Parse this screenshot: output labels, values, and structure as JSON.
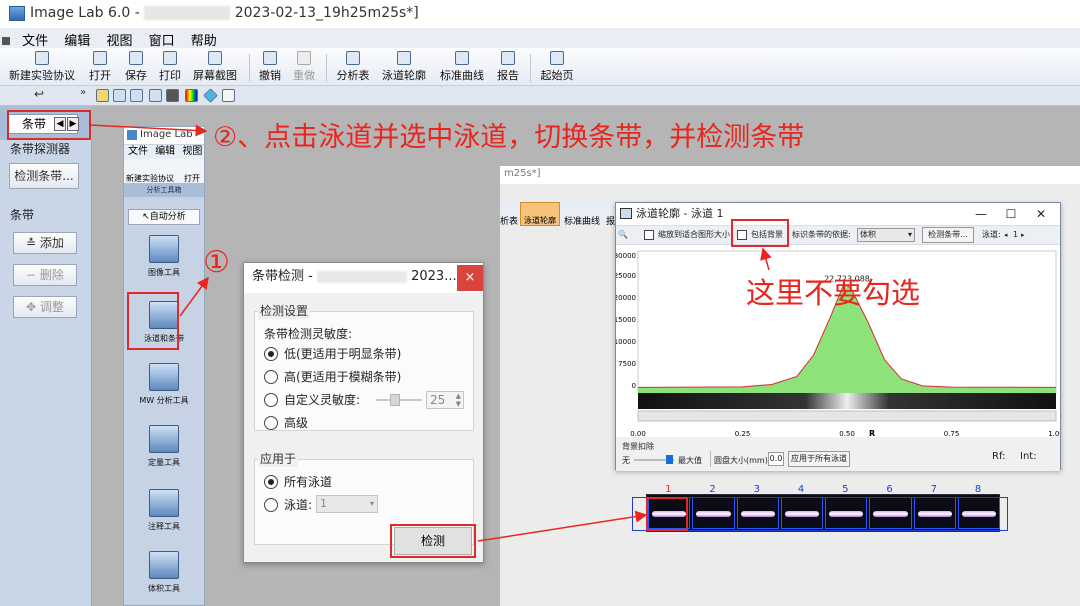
{
  "app": {
    "title_prefix": "Image Lab 6.0 - ",
    "title_suffix": "2023-02-13_19h25m25s*]",
    "menu": [
      "文件",
      "编辑",
      "视图",
      "窗口",
      "帮助"
    ],
    "toolbar": [
      "新建实验协议",
      "打开",
      "保存",
      "打印",
      "屏幕截图",
      "撤销",
      "重做",
      "分析表",
      "泳道轮廓",
      "标准曲线",
      "报告",
      "起始页"
    ],
    "toolbar_disabled": [
      "重做"
    ]
  },
  "left_panel": {
    "tab_label": "条带",
    "section_detector": "条带探测器",
    "detect_button": "检测条带...",
    "section_bands": "条带",
    "add": "添加",
    "delete": "删除",
    "adjust": "调整"
  },
  "inner_window": {
    "title": "Image Lab 6.0",
    "menu": [
      "文件",
      "编辑",
      "视图"
    ],
    "toolbar": [
      "新建实验协议",
      "打开"
    ],
    "strip": "分析工具箱",
    "auto_analyze": "自动分析",
    "tools": [
      "图像工具",
      "泳道和条带",
      "MW 分析工具",
      "定量工具",
      "注释工具",
      "体积工具"
    ]
  },
  "bg_window": {
    "title_fragment": "m25s*]",
    "toolbar": [
      "析表",
      "泳道轮廓",
      "标准曲线",
      "报"
    ]
  },
  "dialog": {
    "title": "条带检测 - ",
    "title_suffix": "2023...",
    "close": "×",
    "group_detect": "检测设置",
    "sensitivity_label": "条带检测灵敏度:",
    "options": [
      "低(更适用于明显条带)",
      "高(更适用于模糊条带)",
      "自定义灵敏度:",
      "高级"
    ],
    "selected_option": 0,
    "custom_value": "25",
    "group_apply": "应用于",
    "apply_options": [
      "所有泳道",
      "泳道:"
    ],
    "selected_apply": 0,
    "lane_value": "1",
    "detect_button": "检测"
  },
  "profile_window": {
    "title": "泳道轮廓 - 泳道 1",
    "minimize": "—",
    "maximize": "☐",
    "close": "✕",
    "fit_label": "缩放到适合图形大小",
    "include_bg": "包括背景",
    "band_basis_label": "标识条带的依据:",
    "band_basis_value": "体积",
    "detect_btn": "检测条带...",
    "lane_label": "泳道:",
    "lane_value": "1",
    "peak_label": "22,723,088",
    "bg_subtract": "背景扣除",
    "slider_min": "无",
    "slider_max": "最大值",
    "disk_size_label": "圆盘大小(mm):",
    "disk_size_value": "0.0",
    "apply_all": "应用于所有泳道",
    "rf_label": "Rf:",
    "int_label": "Int:",
    "r_label": "R"
  },
  "chart_data": {
    "type": "area",
    "y_ticks": [
      "30000",
      "25000",
      "20000",
      "15000",
      "10000",
      "7500",
      "0"
    ],
    "x_ticks": [
      "0.00",
      "0.25",
      "0.50",
      "0.75",
      "1.00"
    ],
    "xlim": [
      0,
      1
    ],
    "ylim": [
      0,
      30000
    ],
    "series": [
      {
        "values": [
          [
            0,
            1200
          ],
          [
            0.25,
            1300
          ],
          [
            0.32,
            1800
          ],
          [
            0.38,
            3500
          ],
          [
            0.42,
            8000
          ],
          [
            0.46,
            16000
          ],
          [
            0.49,
            22500
          ],
          [
            0.5,
            22723
          ],
          [
            0.51,
            22000
          ],
          [
            0.55,
            15000
          ],
          [
            0.59,
            7000
          ],
          [
            0.63,
            3000
          ],
          [
            0.68,
            1500
          ],
          [
            0.75,
            1250
          ],
          [
            1.0,
            1200
          ]
        ]
      }
    ],
    "peak": {
      "x": 0.5,
      "y": 22723
    },
    "fill_color": "#8ee27a",
    "line_color": "#d03030"
  },
  "lanes": [
    "1",
    "2",
    "3",
    "4",
    "5",
    "6",
    "7",
    "8"
  ],
  "annotations": {
    "step1": "①",
    "step2": "②、点击泳道并选中泳道，切换条带，并检测条带",
    "no_check": "这里不要勾选"
  },
  "colors": {
    "annotation": "#e8261e",
    "box": "#e02a2a"
  }
}
